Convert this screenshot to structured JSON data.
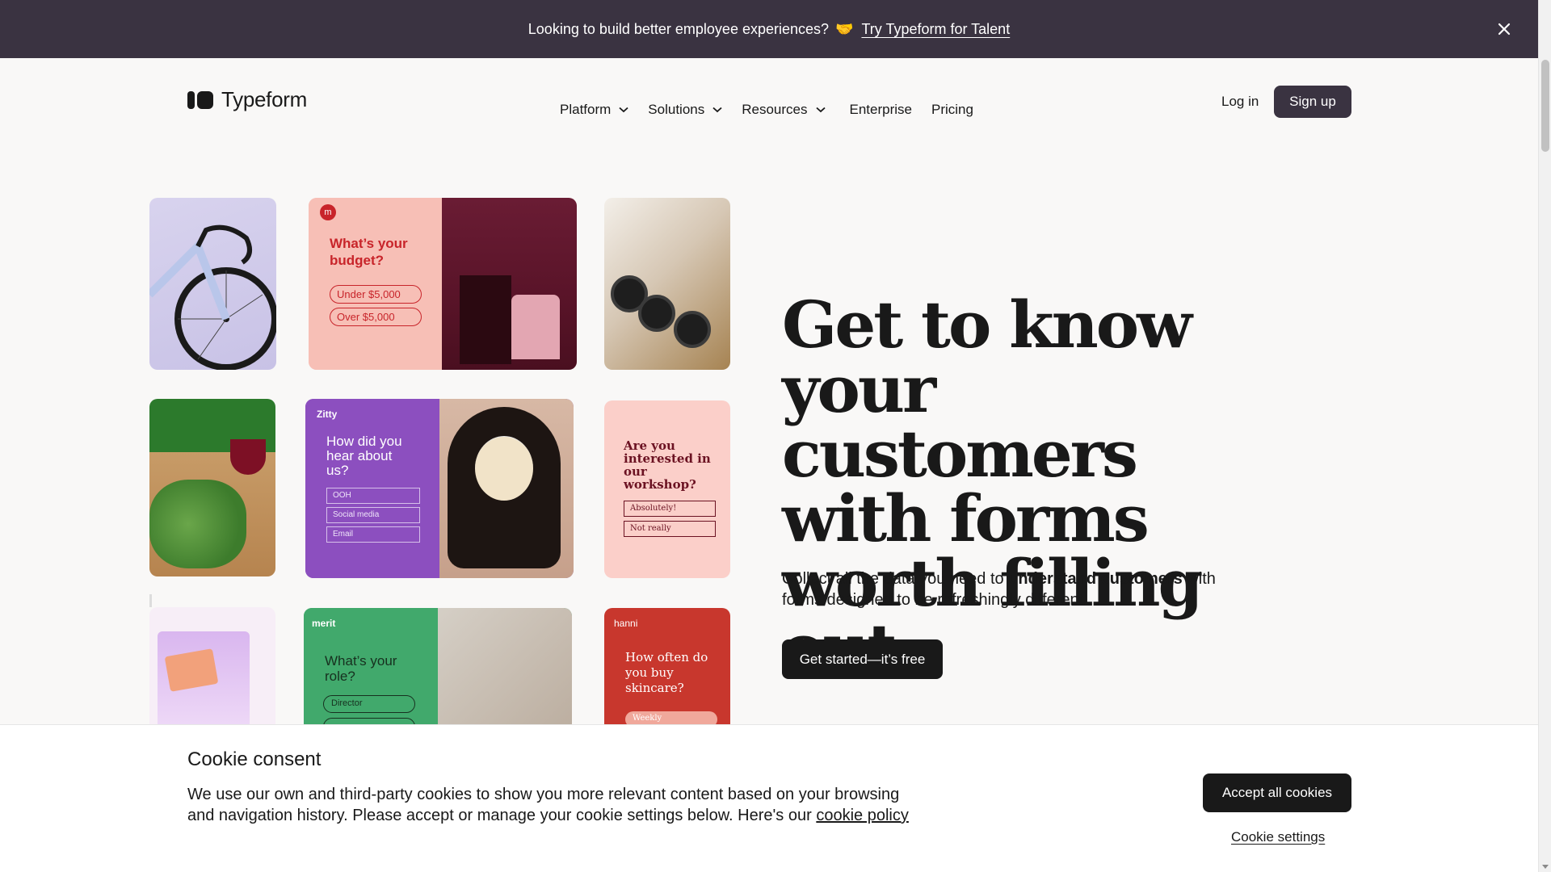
{
  "banner": {
    "message": "Looking to build better employee experiences?",
    "emoji": "🤝",
    "link_label": "Try Typeform for Talent",
    "close_icon": "close-icon"
  },
  "header": {
    "logo_text": "Typeform",
    "nav": [
      {
        "label": "Platform",
        "has_dropdown": true
      },
      {
        "label": "Solutions",
        "has_dropdown": true
      },
      {
        "label": "Resources",
        "has_dropdown": true
      },
      {
        "label": "Enterprise",
        "has_dropdown": false
      },
      {
        "label": "Pricing",
        "has_dropdown": false
      }
    ],
    "login_label": "Log in",
    "signup_label": "Sign up"
  },
  "collage": {
    "budget": {
      "badge": "m",
      "question": "What’s your budget?",
      "options": [
        "Under $5,000",
        "Over $5,000"
      ]
    },
    "zitty": {
      "brand": "Zitty",
      "question": "How did you hear about us?",
      "options": [
        "OOH",
        "Social media",
        "Email"
      ]
    },
    "workshop": {
      "question": "Are you interested in our workshop?",
      "options": [
        "Absolutely!",
        "Not really"
      ]
    },
    "merit": {
      "brand": "merit",
      "question": "What’s your role?",
      "options": [
        "Director"
      ]
    },
    "hanni": {
      "brand": "hanni",
      "question": "How often do you buy skincare?",
      "options": [
        "Weekly"
      ]
    }
  },
  "hero": {
    "title": "Get to know your customers with forms worth filling out",
    "subtitle_pre": "Collect all the data you need to ",
    "subtitle_strong": "understand customers",
    "subtitle_post": " with forms designed to be refreshingly different.",
    "cta_label": "Get started—it’s free"
  },
  "cookie": {
    "title": "Cookie consent",
    "body": "We use our own and third-party cookies to show you more relevant content based on your browsing and navigation history. Please accept or manage your cookie settings below. Here's our ",
    "policy_link": "cookie policy",
    "accept_label": "Accept all cookies",
    "settings_label": "Cookie settings"
  },
  "colors": {
    "banner_bg": "#3a3341",
    "page_bg": "#f9f8f7",
    "primary_button": "#191919",
    "signup_button": "#3a3341"
  }
}
